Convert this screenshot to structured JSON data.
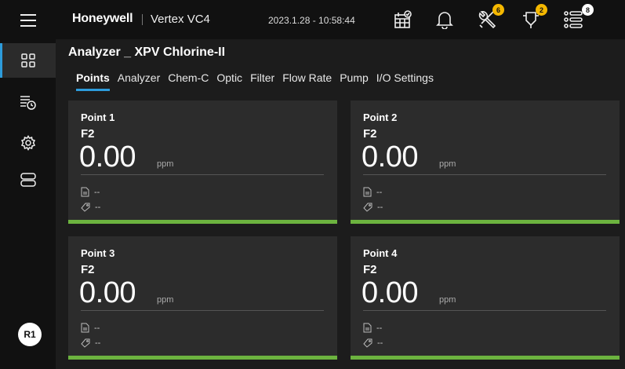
{
  "header": {
    "brand": "Honeywell",
    "product": "Vertex VC4",
    "datetime": "2023.1.28 - 10:58:44",
    "badges": {
      "tools": "6",
      "sensor": "2",
      "events": "8"
    }
  },
  "page": {
    "title": "Analyzer _ XPV Chlorine-II"
  },
  "tabs": [
    {
      "label": "Points",
      "active": true
    },
    {
      "label": "Analyzer"
    },
    {
      "label": "Chem-C"
    },
    {
      "label": "Optic"
    },
    {
      "label": "Filter"
    },
    {
      "label": "Flow Rate"
    },
    {
      "label": "Pump"
    },
    {
      "label": "I/O Settings"
    }
  ],
  "points": [
    {
      "name": "Point 1",
      "param": "F2",
      "value": "0.00",
      "unit": "ppm",
      "file": "--",
      "tag": "--"
    },
    {
      "name": "Point 2",
      "param": "F2",
      "value": "0.00",
      "unit": "ppm",
      "file": "--",
      "tag": "--"
    },
    {
      "name": "Point 3",
      "param": "F2",
      "value": "0.00",
      "unit": "ppm",
      "file": "--",
      "tag": "--"
    },
    {
      "name": "Point 4",
      "param": "F2",
      "value": "0.00",
      "unit": "ppm",
      "file": "--",
      "tag": "--"
    }
  ],
  "user": {
    "initials": "R1"
  },
  "colors": {
    "accent": "#2d9cdb",
    "status_ok": "#6cb33f",
    "badge": "#f5b800"
  }
}
